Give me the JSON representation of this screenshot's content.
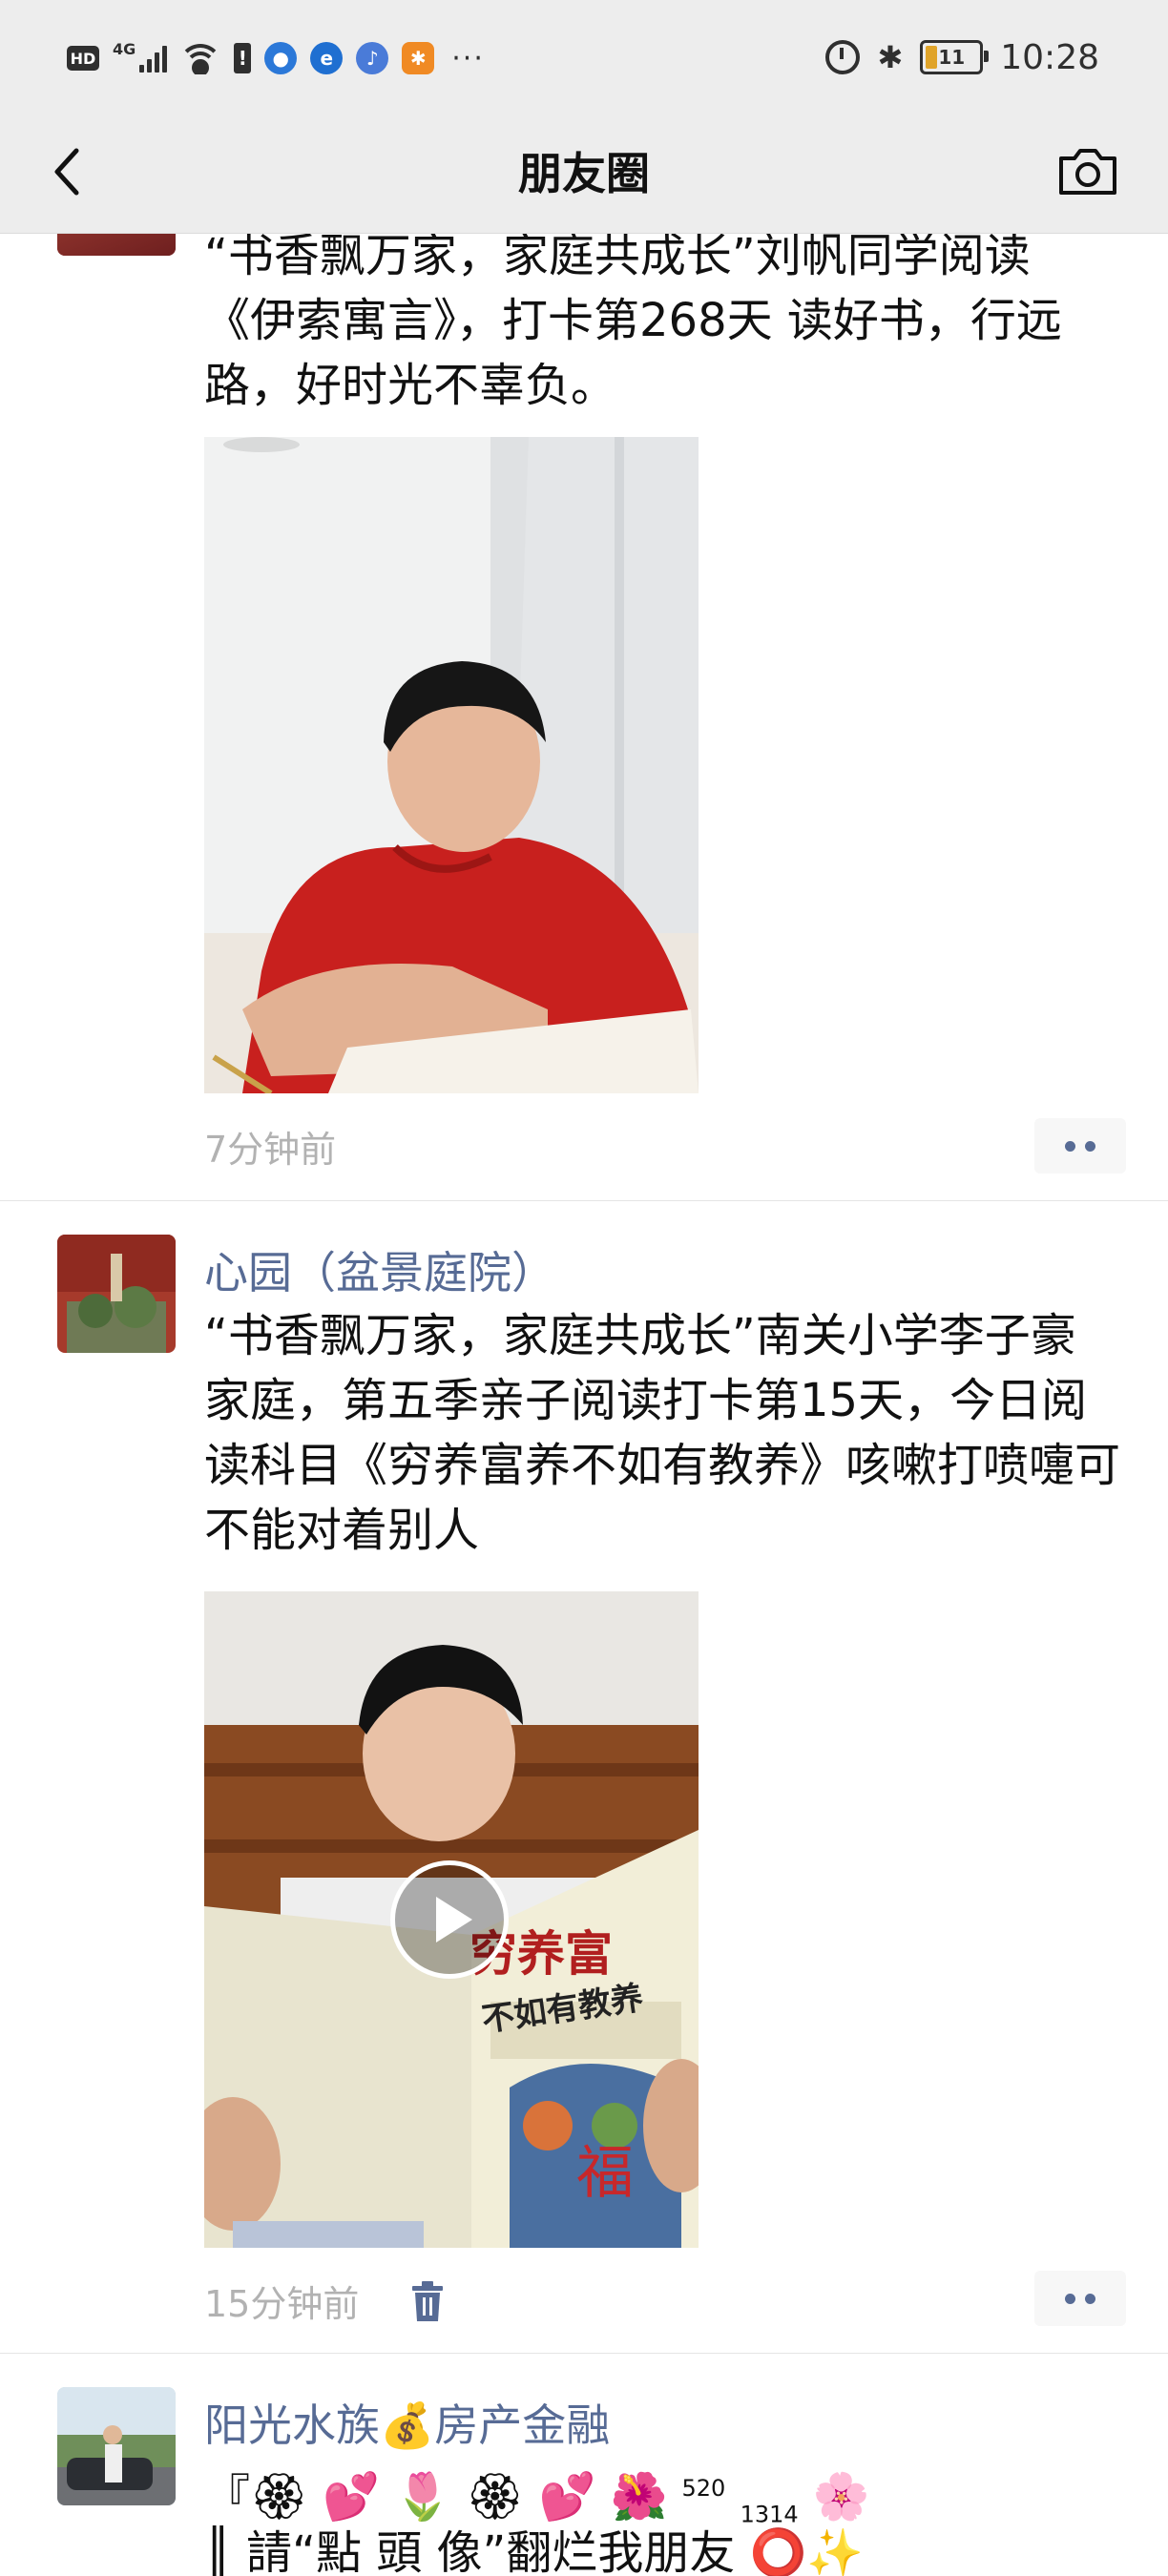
{
  "status_bar": {
    "hd": "HD",
    "network": "4G",
    "alert": "!",
    "more": "···",
    "battery": "11",
    "time": "10:28"
  },
  "nav": {
    "title": "朋友圈",
    "back_icon": "chevron-left-icon",
    "camera_icon": "camera-icon"
  },
  "posts": [
    {
      "text": "“书香飘万家，家庭共成长”刘帆同学阅读《伊索寓言》，打卡第268天 读好书，行远路，好时光不辜负。",
      "media": "photo",
      "time": "7分钟前"
    },
    {
      "name": "心园（盆景庭院）",
      "text": "“书香飘万家，家庭共成长”南关小学李子豪家庭，第五季亲子阅读打卡第15天，今日阅读科目《穷养富养不如有教养》咳嗽打喷嚏可不能对着别人",
      "media": "video",
      "book_title_1": "穷养富",
      "book_title_2": "不如有教养",
      "time": "15分钟前",
      "delete_icon": "trash-icon"
    },
    {
      "name": "阳光水族💰房产金融",
      "line1_a": "『🏵 💕 🌷 🏵 💕 🌺",
      "line1_sup": "520",
      "line1_sub": "1314",
      "line1_b": "🌸",
      "line2": "║ 請“點 頭 像”翻烂我朋友 ⭕✨"
    }
  ],
  "colors": {
    "name_link": "#576b95",
    "time_gray": "#b2b2b2",
    "bar_bg": "#ededed"
  }
}
